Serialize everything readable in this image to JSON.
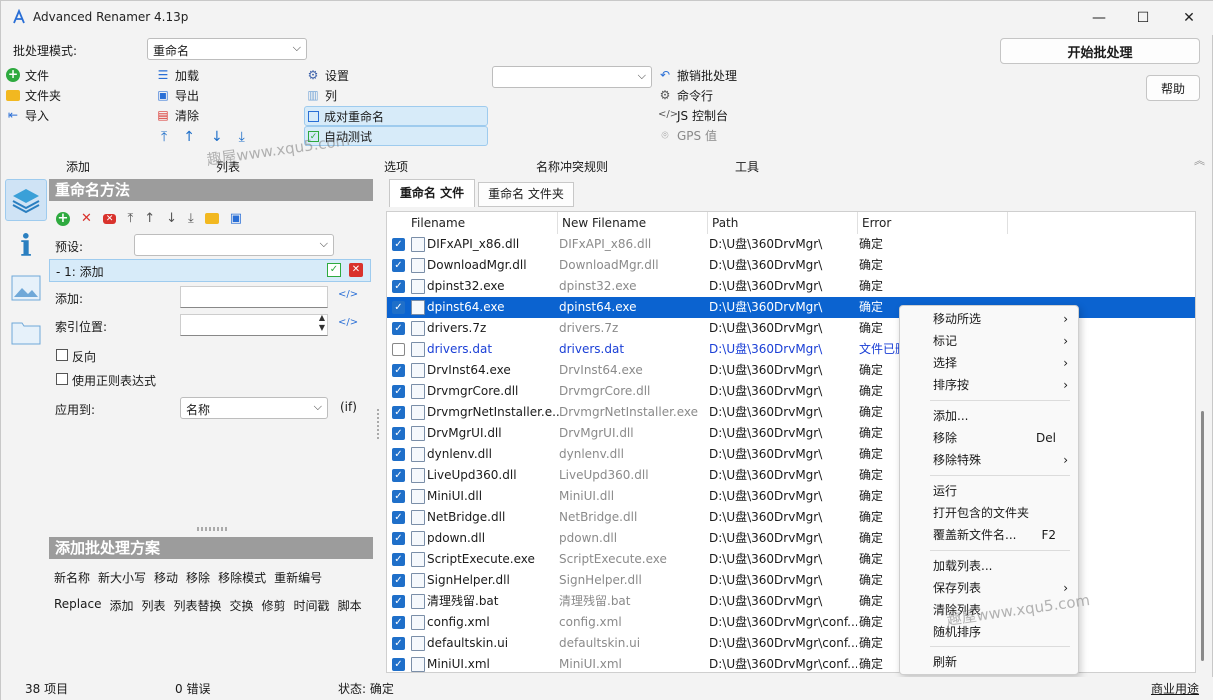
{
  "app": {
    "title": "Advanced Renamer 4.13p",
    "min": "—",
    "max": "☐",
    "close": "✕"
  },
  "batch": {
    "mode_label": "批处理模式:",
    "mode_value": "重命名",
    "start_button": "开始批处理",
    "help_button": "帮助"
  },
  "toolbar": {
    "add_file": "文件",
    "add_folder": "文件夹",
    "import": "导入",
    "load": "加载",
    "export": "导出",
    "clear": "清除",
    "settings": "设置",
    "columns": "列",
    "pair_rename": "成对重命名",
    "auto_test": "自动测试",
    "undo": "撤销批处理",
    "cmd": "命令行",
    "js": "JS 控制台",
    "gps": "GPS 值"
  },
  "sections": {
    "add": "添加",
    "list": "列表",
    "options": "选项",
    "conflict": "名称冲突规则",
    "tools": "工具"
  },
  "left": {
    "methods_title": "重命名方法",
    "preset_label": "预设:",
    "method_item": "- 1: 添加",
    "add_label": "添加:",
    "index_label": "索引位置:",
    "reverse_label": "反向",
    "regex_label": "使用正则表达式",
    "apply_label": "应用到:",
    "apply_value": "名称",
    "if_label": "(if)",
    "tag_icon": "</>",
    "batch_title": "添加批处理方案",
    "methods_row1": [
      "新名称",
      "新大小写",
      "移动",
      "移除",
      "移除模式",
      "重新编号"
    ],
    "methods_row2": [
      "Replace",
      "添加",
      "列表",
      "列表替换",
      "交换",
      "修剪",
      "时间戳",
      "脚本"
    ]
  },
  "tabs": {
    "files": "重命名 文件",
    "folders": "重命名 文件夹"
  },
  "grid": {
    "headers": [
      "Filename",
      "New Filename",
      "Path",
      "Error"
    ],
    "rows": [
      {
        "f": "DIFxAPI_x86.dll",
        "n": "DIFxAPI_x86.dll",
        "p": "D:\\U盘\\360DrvMgr\\",
        "e": "确定"
      },
      {
        "f": "DownloadMgr.dll",
        "n": "DownloadMgr.dll",
        "p": "D:\\U盘\\360DrvMgr\\",
        "e": "确定"
      },
      {
        "f": "dpinst32.exe",
        "n": "dpinst32.exe",
        "p": "D:\\U盘\\360DrvMgr\\",
        "e": "确定"
      },
      {
        "f": "dpinst64.exe",
        "n": "dpinst64.exe",
        "p": "D:\\U盘\\360DrvMgr\\",
        "e": "确定"
      },
      {
        "f": "drivers.7z",
        "n": "drivers.7z",
        "p": "D:\\U盘\\360DrvMgr\\",
        "e": "确定"
      },
      {
        "f": "drivers.dat",
        "n": "drivers.dat",
        "p": "D:\\U盘\\360DrvMgr\\",
        "e": "文件已删"
      },
      {
        "f": "DrvInst64.exe",
        "n": "DrvInst64.exe",
        "p": "D:\\U盘\\360DrvMgr\\",
        "e": "确定"
      },
      {
        "f": "DrvmgrCore.dll",
        "n": "DrvmgrCore.dll",
        "p": "D:\\U盘\\360DrvMgr\\",
        "e": "确定"
      },
      {
        "f": "DrvmgrNetInstaller.e...",
        "n": "DrvmgrNetInstaller.exe",
        "p": "D:\\U盘\\360DrvMgr\\",
        "e": "确定"
      },
      {
        "f": "DrvMgrUI.dll",
        "n": "DrvMgrUI.dll",
        "p": "D:\\U盘\\360DrvMgr\\",
        "e": "确定"
      },
      {
        "f": "dynlenv.dll",
        "n": "dynlenv.dll",
        "p": "D:\\U盘\\360DrvMgr\\",
        "e": "确定"
      },
      {
        "f": "LiveUpd360.dll",
        "n": "LiveUpd360.dll",
        "p": "D:\\U盘\\360DrvMgr\\",
        "e": "确定"
      },
      {
        "f": "MiniUI.dll",
        "n": "MiniUI.dll",
        "p": "D:\\U盘\\360DrvMgr\\",
        "e": "确定"
      },
      {
        "f": "NetBridge.dll",
        "n": "NetBridge.dll",
        "p": "D:\\U盘\\360DrvMgr\\",
        "e": "确定"
      },
      {
        "f": "pdown.dll",
        "n": "pdown.dll",
        "p": "D:\\U盘\\360DrvMgr\\",
        "e": "确定"
      },
      {
        "f": "ScriptExecute.exe",
        "n": "ScriptExecute.exe",
        "p": "D:\\U盘\\360DrvMgr\\",
        "e": "确定"
      },
      {
        "f": "SignHelper.dll",
        "n": "SignHelper.dll",
        "p": "D:\\U盘\\360DrvMgr\\",
        "e": "确定"
      },
      {
        "f": "清理残留.bat",
        "n": "清理残留.bat",
        "p": "D:\\U盘\\360DrvMgr\\",
        "e": "确定"
      },
      {
        "f": "config.xml",
        "n": "config.xml",
        "p": "D:\\U盘\\360DrvMgr\\conf...",
        "e": "确定"
      },
      {
        "f": "defaultskin.ui",
        "n": "defaultskin.ui",
        "p": "D:\\U盘\\360DrvMgr\\conf...",
        "e": "确定"
      },
      {
        "f": "MiniUI.xml",
        "n": "MiniUI.xml",
        "p": "D:\\U盘\\360DrvMgr\\conf...",
        "e": "确定"
      }
    ]
  },
  "menu": {
    "items": [
      "移动所选",
      "标记",
      "选择",
      "排序按",
      "添加...",
      "移除",
      "移除特殊",
      "运行",
      "打开包含的文件夹",
      "覆盖新文件名...",
      "加载列表...",
      "保存列表",
      "清除列表",
      "随机排序",
      "刷新"
    ],
    "del": "Del",
    "f2": "F2",
    "sub": "›"
  },
  "watermark": {
    "text1": "趣屋www.xqu5.com",
    "text2": "趣屋www.xqu5.com"
  },
  "status": {
    "count": "38 项目",
    "errors": "0 错误",
    "state": "状态: 确定",
    "license": "商业用途"
  }
}
